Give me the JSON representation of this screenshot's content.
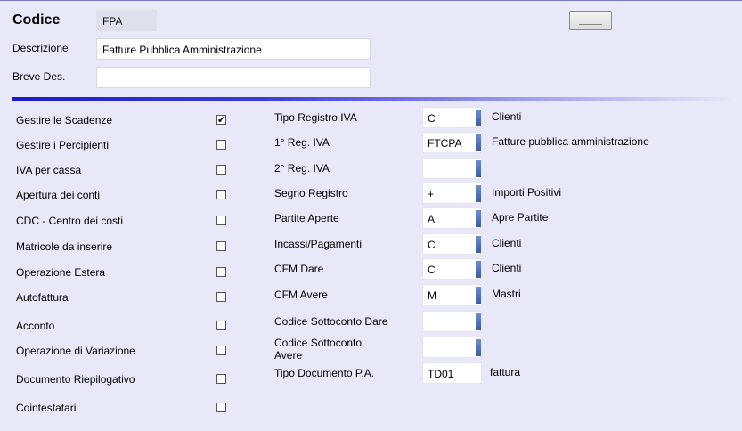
{
  "header": {
    "codice_label": "Codice",
    "codice_value": "FPA",
    "descrizione_label": "Descrizione",
    "descrizione_value": "Fatture Pubblica Amministrazione",
    "breve_label": "Breve Des.",
    "breve_value": ""
  },
  "options": [
    {
      "label": "Gestire le Scadenze",
      "checked": true
    },
    {
      "label": "Gestire i Percipienti",
      "checked": false
    },
    {
      "label": "IVA per cassa",
      "checked": false
    },
    {
      "label": "Apertura dei conti",
      "checked": false
    },
    {
      "label": "CDC - Centro dei costi",
      "checked": false
    },
    {
      "label": "Matricole da inserire",
      "checked": false
    },
    {
      "label": "Operazione Estera",
      "checked": false
    },
    {
      "label": "Autofattura",
      "checked": false
    },
    {
      "label": "Acconto",
      "checked": false
    },
    {
      "label": "Operazione di Variazione",
      "checked": false
    },
    {
      "label": "Documento Riepilogativo",
      "checked": false
    },
    {
      "label": "Cointestatari",
      "checked": false
    }
  ],
  "fields": [
    {
      "label": "Tipo Registro IVA",
      "value": "C",
      "desc": "Clienti"
    },
    {
      "label": "1° Reg. IVA",
      "value": "FTCPA",
      "desc": "Fatture pubblica amministrazione"
    },
    {
      "label": "2° Reg. IVA",
      "value": "",
      "desc": ""
    },
    {
      "label": "Segno Registro",
      "value": "+",
      "desc": "Importi Positivi"
    },
    {
      "label": "Partite Aperte",
      "value": "A",
      "desc": "Apre Partite"
    },
    {
      "label": "Incassi/Pagamenti",
      "value": "C",
      "desc": "Clienti"
    },
    {
      "label": "CFM Dare",
      "value": "C",
      "desc": "Clienti"
    },
    {
      "label": "CFM Avere",
      "value": "M",
      "desc": "Mastri"
    },
    {
      "label": "Codice Sottoconto Dare",
      "value": "",
      "desc": ""
    },
    {
      "label": "Codice Sottoconto Avere",
      "value": "",
      "desc": ""
    },
    {
      "label": "Tipo Documento P.A.",
      "value": "TD01",
      "desc": "fattura"
    }
  ],
  "colors": {
    "background": "#e8e8f8",
    "separator": "#1c1cc8",
    "dropdown_bar": "#3c5d9a"
  }
}
